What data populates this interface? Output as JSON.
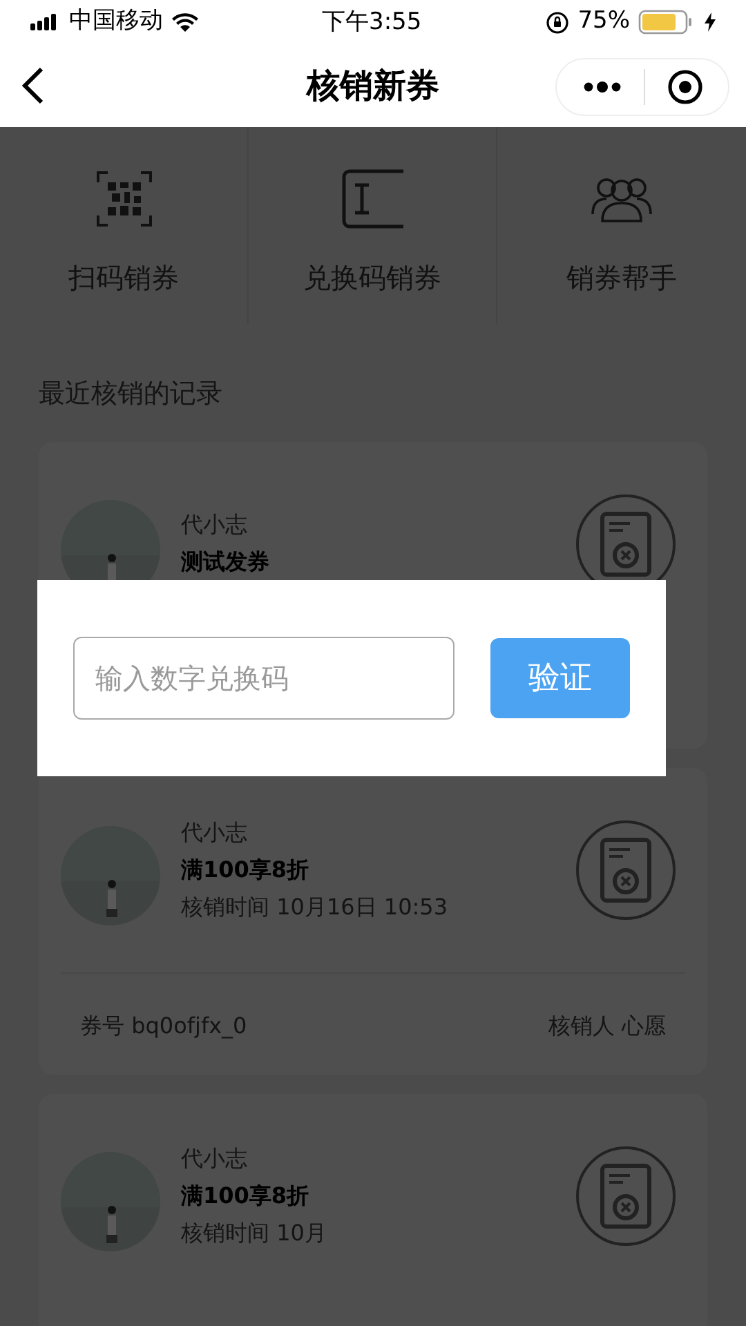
{
  "status_bar": {
    "carrier": "中国移动",
    "time": "下午3:55",
    "battery": "75%"
  },
  "nav": {
    "title": "核销新券"
  },
  "actions": [
    {
      "kind": "scan",
      "label": "扫码销券"
    },
    {
      "kind": "code",
      "label": "兑换码销券"
    },
    {
      "kind": "helper",
      "label": "销券帮手"
    }
  ],
  "section_title": "最近核销的记录",
  "records": [
    {
      "name": "代小志",
      "title": "测试发券"
    },
    {
      "name": "代小志",
      "title": "满100享8折",
      "time": "核销时间 10月16日 10:53",
      "coupon_no": "券号 bq0ofjfx_0",
      "verifier": "核销人 心愿"
    },
    {
      "name": "代小志",
      "title": "满100享8折",
      "time": "核销时间 10月"
    }
  ],
  "dialog": {
    "placeholder": "输入数字兑换码",
    "button": "验证"
  }
}
